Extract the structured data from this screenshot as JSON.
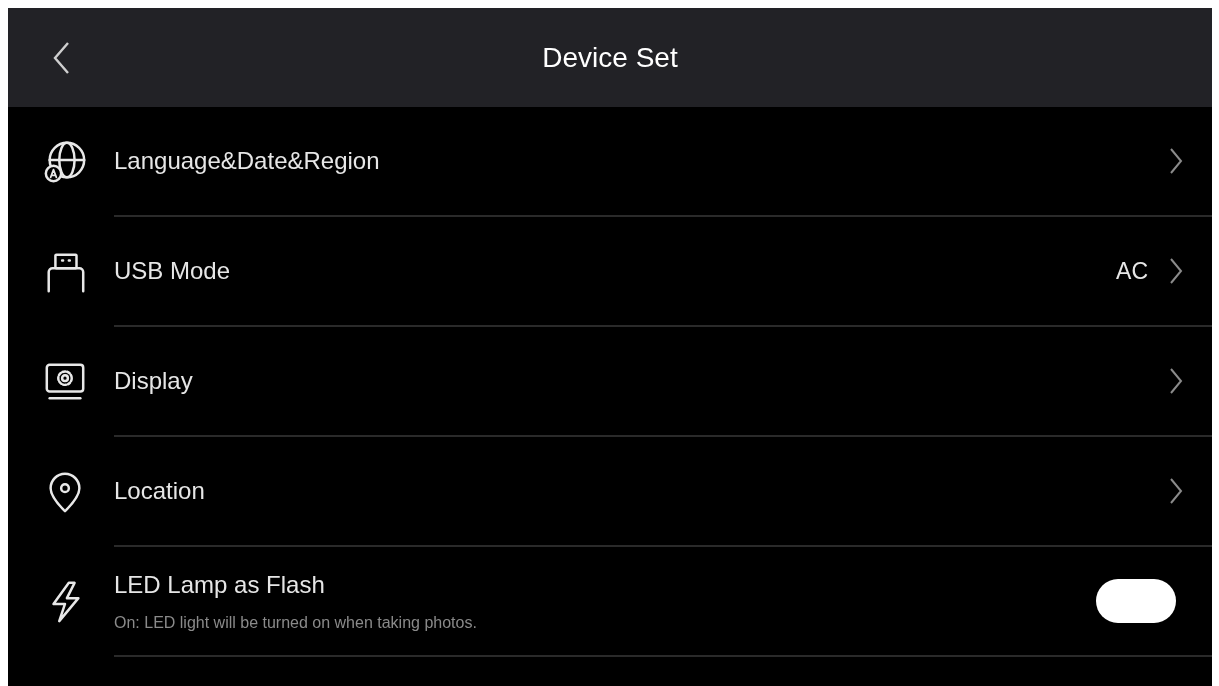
{
  "header": {
    "title": "Device Set"
  },
  "items": [
    {
      "kind": "link",
      "label": "Language&Date&Region"
    },
    {
      "kind": "link",
      "label": "USB Mode",
      "value": "AC"
    },
    {
      "kind": "link",
      "label": "Display"
    },
    {
      "kind": "link",
      "label": "Location"
    },
    {
      "kind": "toggle",
      "label": "LED Lamp as Flash",
      "description": "On: LED light will be turned on when taking photos.",
      "on": true
    }
  ]
}
